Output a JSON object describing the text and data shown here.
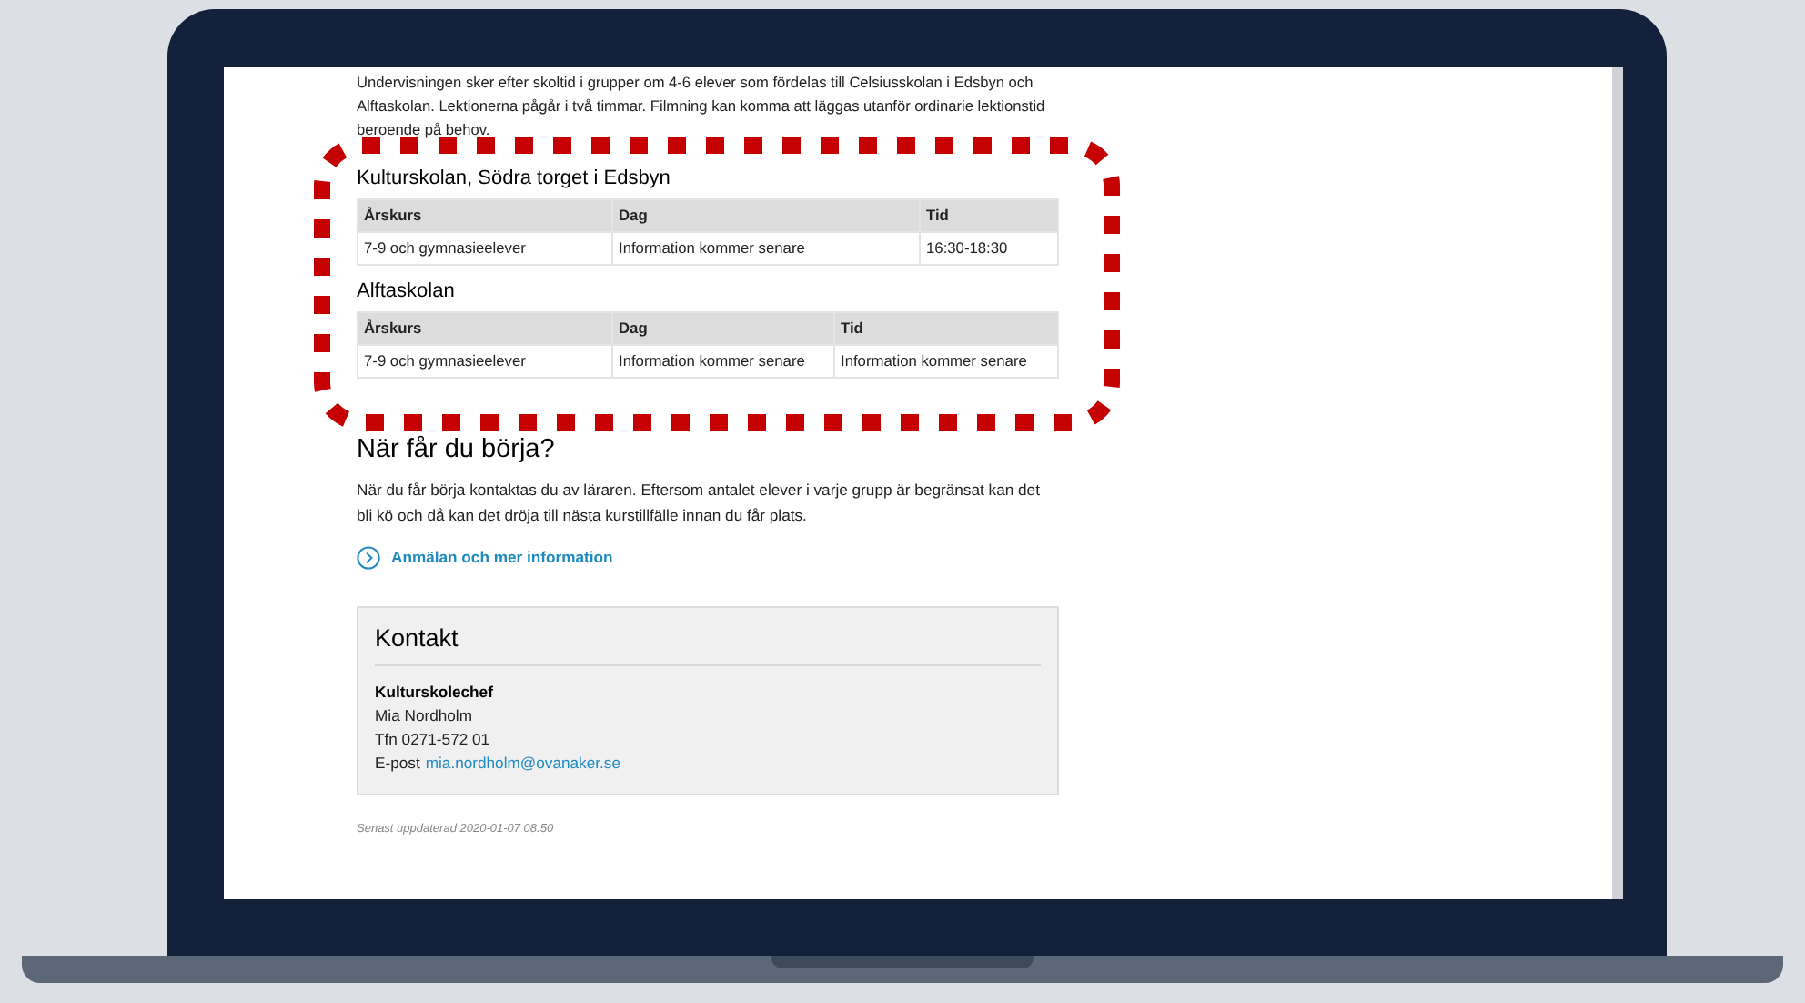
{
  "intro": "Undervisningen sker efter skoltid i grupper om 4-6 elever som fördelas till Celsiusskolan i Edsbyn och Alftaskolan. Lektionerna pågår i två timmar. Filmning kan komma att läggas utanför ordinarie lektionstid beroende på behov.",
  "schedules": [
    {
      "title": "Kulturskolan, Södra torget i Edsbyn",
      "columns": [
        "Årskurs",
        "Dag",
        "Tid"
      ],
      "rows": [
        [
          "7-9 och gymnasieelever",
          "Information kommer senare",
          "16:30-18:30"
        ]
      ]
    },
    {
      "title": "Alftaskolan",
      "columns": [
        "Årskurs",
        "Dag",
        "Tid"
      ],
      "rows": [
        [
          "7-9 och gymnasieelever",
          "Information kommer senare",
          "Information kommer senare"
        ]
      ]
    }
  ],
  "start_section": {
    "heading": "När får du börja?",
    "body": "När du får börja kontaktas du av läraren. Eftersom antalet elever i varje grupp är begränsat kan det bli kö och då kan det dröja till nästa kurstillfälle innan du får plats."
  },
  "link": {
    "label": "Anmälan och mer information"
  },
  "contact": {
    "heading": "Kontakt",
    "role": "Kulturskolechef",
    "name": "Mia Nordholm",
    "phone": "Tfn 0271-572 01",
    "email_label": "E-post",
    "email": "mia.nordholm@ovanaker.se"
  },
  "updated": "Senast uppdaterad 2020-01-07 08.50"
}
